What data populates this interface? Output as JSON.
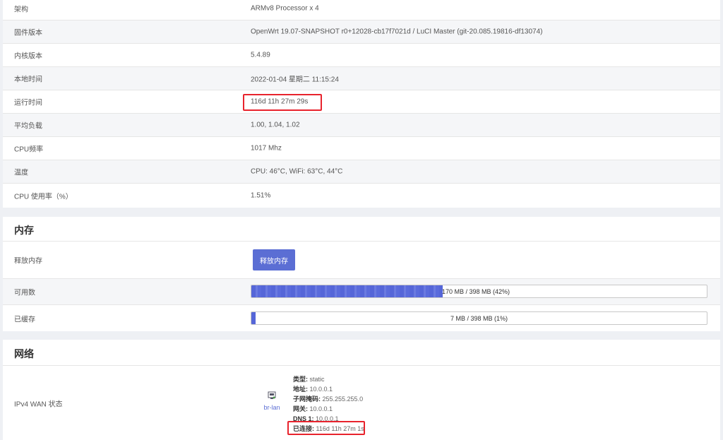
{
  "system": {
    "rows": [
      {
        "label": "架构",
        "value": "ARMv8 Processor x 4"
      },
      {
        "label": "固件版本",
        "value": "OpenWrt 19.07-SNAPSHOT r0+12028-cb17f7021d / LuCI Master (git-20.085.19816-df13074)"
      },
      {
        "label": "内核版本",
        "value": "5.4.89"
      },
      {
        "label": "本地时间",
        "value": "2022-01-04 星期二 11:15:24"
      },
      {
        "label": "运行时间",
        "value": "116d 11h 27m 29s"
      },
      {
        "label": "平均负载",
        "value": "1.00, 1.04, 1.02"
      },
      {
        "label": "CPU频率",
        "value": "1017 Mhz"
      },
      {
        "label": "温度",
        "value": "CPU: 46°C, WiFi: 63°C, 44°C"
      },
      {
        "label": "CPU 使用率（%）",
        "value": "1.51%"
      }
    ]
  },
  "memory": {
    "title": "内存",
    "release_label": "释放内存",
    "release_button": "释放内存",
    "available_label": "可用数",
    "available_text": "170 MB / 398 MB (42%)",
    "available_fraction": 0.42,
    "cached_label": "已缓存",
    "cached_text": "7 MB / 398 MB (1%)",
    "cached_fraction": 0.01
  },
  "network": {
    "title": "网络",
    "wan_label": "IPv4 WAN 状态",
    "interface_name": "br-lan",
    "interface_icon": "ethernet-port-icon",
    "details": [
      {
        "key": "类型:",
        "value": "static"
      },
      {
        "key": "地址:",
        "value": "10.0.0.1"
      },
      {
        "key": "子网掩码:",
        "value": "255.255.255.0"
      },
      {
        "key": "网关:",
        "value": "10.0.0.1"
      },
      {
        "key": "DNS 1:",
        "value": "10.0.0.1"
      },
      {
        "key": "已连接:",
        "value": "116d 11h 27m 1s"
      }
    ]
  },
  "colors": {
    "accent": "#5b6ed4",
    "highlight_box": "#e8232d",
    "page_background": "#eef0f4"
  }
}
